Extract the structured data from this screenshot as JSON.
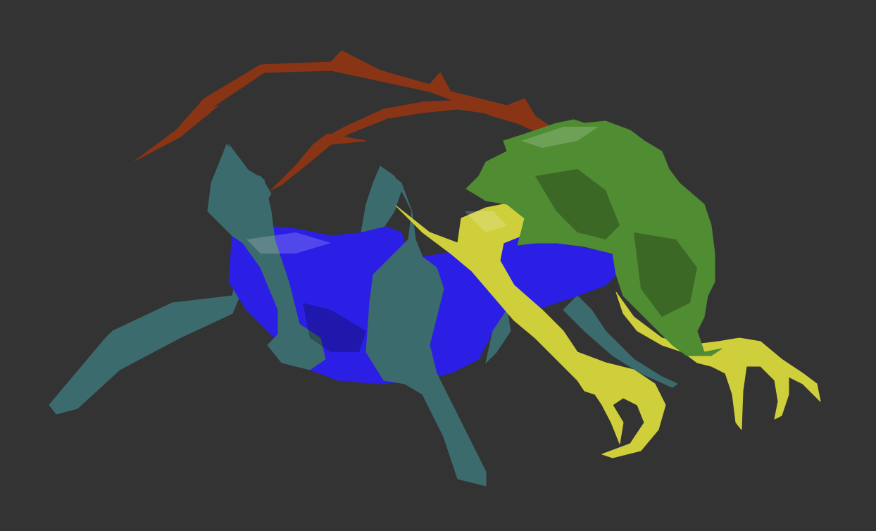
{
  "viewport": {
    "background": "#333333"
  },
  "model": {
    "parts": [
      {
        "name": "antennae",
        "color": "#8a3416"
      },
      {
        "name": "legs",
        "color": "#3c6b6e"
      },
      {
        "name": "abdomen",
        "color": "#2b1fe6"
      },
      {
        "name": "claws",
        "color": "#cfcf3c"
      },
      {
        "name": "head-carapace",
        "color": "#4f8c32"
      }
    ]
  }
}
